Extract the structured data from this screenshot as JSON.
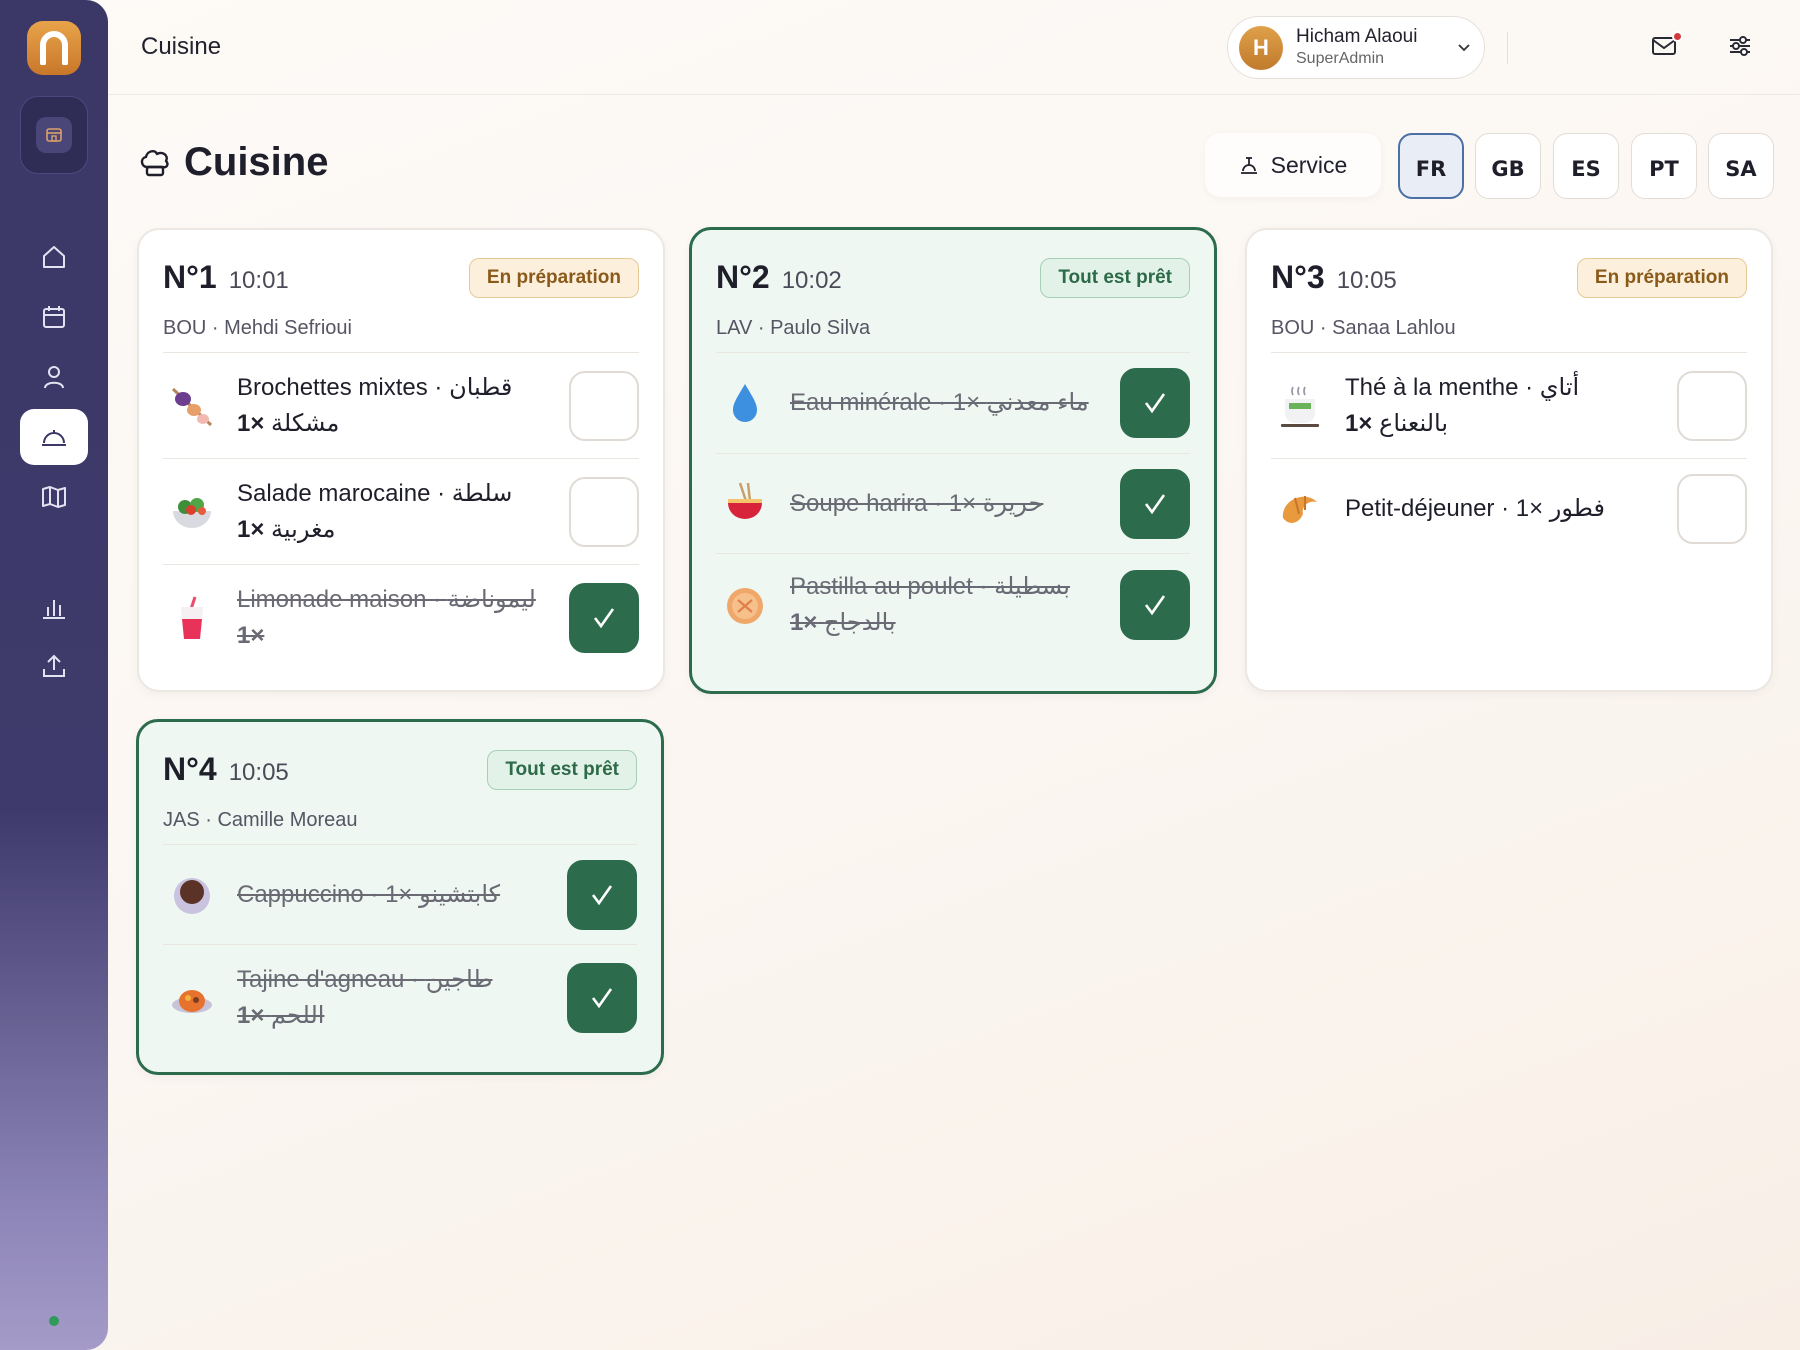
{
  "header": {
    "title": "Cuisine",
    "user": {
      "initial": "H",
      "name": "Hicham Alaoui",
      "role": "SuperAdmin"
    }
  },
  "page": {
    "title": "Cuisine",
    "service_label": "Service",
    "languages": [
      "FR",
      "GB",
      "ES",
      "PT",
      "SA"
    ],
    "active_language": "FR"
  },
  "orders": [
    {
      "number": "N°1",
      "time": "10:01",
      "status": "En préparation",
      "table": "BOU · Mehdi Sefrioui",
      "items": [
        {
          "name": "Brochettes mixtes · قطبان",
          "line2_qty": "1×",
          "line2_text": " مشكلة",
          "done": false,
          "icon": "skewer-icon"
        },
        {
          "name": "Salade marocaine · سلطة",
          "line2_qty": "1×",
          "line2_text": " مغربية",
          "done": false,
          "icon": "salad-icon"
        },
        {
          "name": "Limonade maison · ليموناضة",
          "line2_qty": "1×",
          "line2_text": "",
          "done": true,
          "icon": "drink-cup-icon"
        }
      ]
    },
    {
      "number": "N°2",
      "time": "10:02",
      "status": "Tout est prêt",
      "table": "LAV · Paulo Silva",
      "items": [
        {
          "name": "Eau minérale · 1× ماء معدني",
          "line2_qty": "",
          "line2_text": "",
          "done": true,
          "icon": "water-drop-icon"
        },
        {
          "name": "Soupe harira · 1× حريرة",
          "line2_qty": "",
          "line2_text": "",
          "done": true,
          "icon": "noodle-bowl-icon"
        },
        {
          "name": "Pastilla au poulet · بسطيلة",
          "line2_qty": "1×",
          "line2_text": " بالدجاج",
          "done": true,
          "icon": "pastilla-icon"
        }
      ]
    },
    {
      "number": "N°3",
      "time": "10:05",
      "status": "En préparation",
      "table": "BOU · Sanaa Lahlou",
      "items": [
        {
          "name": "Thé à la menthe · أتاي",
          "line2_qty": "1×",
          "line2_text": " بالنعناع",
          "done": false,
          "icon": "tea-cup-icon"
        },
        {
          "name": "Petit-déjeuner · 1× فطور",
          "line2_qty": "",
          "line2_text": "",
          "done": false,
          "icon": "croissant-icon"
        }
      ]
    },
    {
      "number": "N°4",
      "time": "10:05",
      "status": "Tout est prêt",
      "table": "JAS · Camille Moreau",
      "items": [
        {
          "name": "Cappuccino · 1× كابتشينو",
          "line2_qty": "",
          "line2_text": "",
          "done": true,
          "icon": "coffee-cup-icon"
        },
        {
          "name": "Tajine d'agneau · طاجين",
          "line2_qty": "1×",
          "line2_text": " اللحم",
          "done": true,
          "icon": "tajine-icon"
        }
      ]
    }
  ],
  "colors": {
    "sidebar": "#3b3867",
    "accent_green": "#2c6c4d",
    "badge_prep": "#fcf0dd",
    "badge_ready": "#e2f2e8",
    "logo": "#d98b36"
  }
}
